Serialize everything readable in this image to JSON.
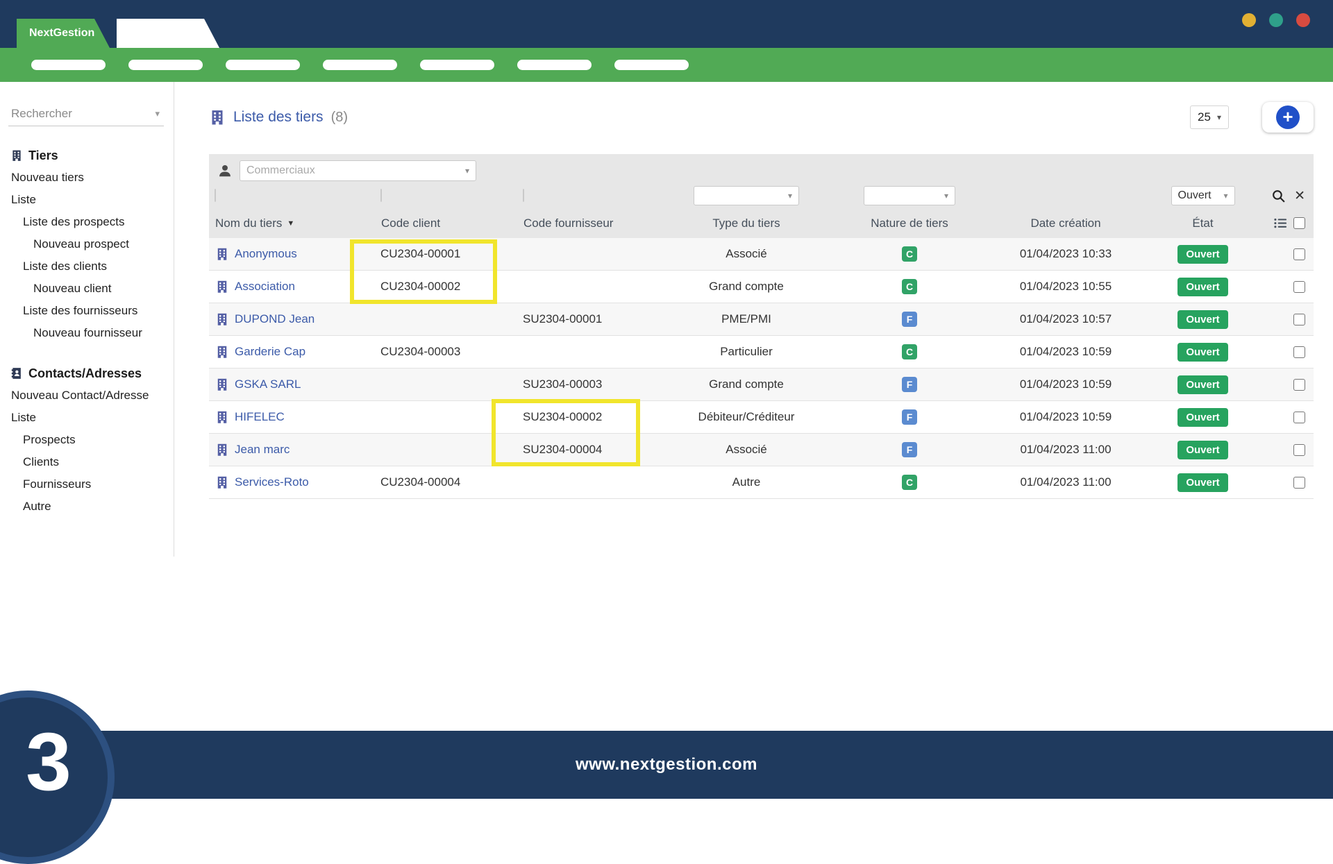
{
  "window": {
    "brand": "NextGestion"
  },
  "navbar": {
    "placeholder_count": 7
  },
  "sidebar": {
    "search_placeholder": "Rechercher",
    "sections": [
      {
        "title": "Tiers",
        "icon": "building-icon",
        "items": [
          {
            "label": "Nouveau tiers",
            "indent": 0
          },
          {
            "label": "Liste",
            "indent": 0
          },
          {
            "label": "Liste des prospects",
            "indent": 1
          },
          {
            "label": "Nouveau prospect",
            "indent": 2
          },
          {
            "label": "Liste des clients",
            "indent": 1
          },
          {
            "label": "Nouveau client",
            "indent": 2
          },
          {
            "label": "Liste des fournisseurs",
            "indent": 1
          },
          {
            "label": "Nouveau fournisseur",
            "indent": 2
          }
        ]
      },
      {
        "title": "Contacts/Adresses",
        "icon": "contacts-icon",
        "items": [
          {
            "label": "Nouveau Contact/Adresse",
            "indent": 0
          },
          {
            "label": "Liste",
            "indent": 0
          },
          {
            "label": "Prospects",
            "indent": 1
          },
          {
            "label": "Clients",
            "indent": 1
          },
          {
            "label": "Fournisseurs",
            "indent": 1
          },
          {
            "label": "Autre",
            "indent": 1
          }
        ]
      }
    ]
  },
  "main": {
    "title": "Liste des tiers",
    "count_label": "(8)",
    "page_size": "25",
    "add_button": "+",
    "filters": {
      "commercial_placeholder": "Commerciaux",
      "etat_value": "Ouvert"
    },
    "columns": [
      "Nom du tiers",
      "Code client",
      "Code fournisseur",
      "Type du tiers",
      "Nature de tiers",
      "Date création",
      "État"
    ],
    "rows": [
      {
        "name": "Anonymous",
        "code_client": "CU2304-00001",
        "code_fournisseur": "",
        "type": "Associé",
        "nature": "C",
        "date": "01/04/2023 10:33",
        "etat": "Ouvert"
      },
      {
        "name": "Association",
        "code_client": "CU2304-00002",
        "code_fournisseur": "",
        "type": "Grand compte",
        "nature": "C",
        "date": "01/04/2023 10:55",
        "etat": "Ouvert"
      },
      {
        "name": "DUPOND Jean",
        "code_client": "",
        "code_fournisseur": "SU2304-00001",
        "type": "PME/PMI",
        "nature": "F",
        "date": "01/04/2023 10:57",
        "etat": "Ouvert"
      },
      {
        "name": "Garderie Cap",
        "code_client": "CU2304-00003",
        "code_fournisseur": "",
        "type": "Particulier",
        "nature": "C",
        "date": "01/04/2023 10:59",
        "etat": "Ouvert"
      },
      {
        "name": "GSKA SARL",
        "code_client": "",
        "code_fournisseur": "SU2304-00003",
        "type": "Grand compte",
        "nature": "F",
        "date": "01/04/2023 10:59",
        "etat": "Ouvert"
      },
      {
        "name": "HIFELEC",
        "code_client": "",
        "code_fournisseur": "SU2304-00002",
        "type": "Débiteur/Créditeur",
        "nature": "F",
        "date": "01/04/2023 10:59",
        "etat": "Ouvert"
      },
      {
        "name": "Jean marc",
        "code_client": "",
        "code_fournisseur": "SU2304-00004",
        "type": "Associé",
        "nature": "F",
        "date": "01/04/2023 11:00",
        "etat": "Ouvert"
      },
      {
        "name": "Services-Roto",
        "code_client": "CU2304-00004",
        "code_fournisseur": "",
        "type": "Autre",
        "nature": "C",
        "date": "01/04/2023 11:00",
        "etat": "Ouvert"
      }
    ]
  },
  "footer": {
    "url": "www.nextgestion.com",
    "step": "3"
  },
  "colors": {
    "navy": "#1f3a5e",
    "green": "#51aa55",
    "link_blue": "#3c5ba9",
    "open_badge": "#27a35f",
    "nature_c": "#31a367",
    "nature_f": "#5b8bd0",
    "highlight_yellow": "#f1e52c",
    "add_button_blue": "#2050c8"
  }
}
